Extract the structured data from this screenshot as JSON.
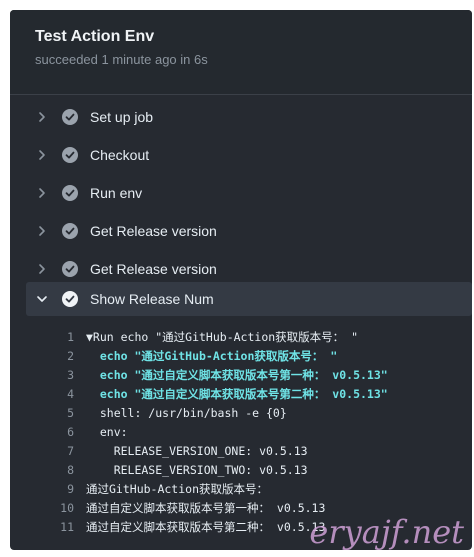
{
  "header": {
    "title": "Test Action Env",
    "subtitle": "succeeded 1 minute ago in 6s"
  },
  "steps": [
    {
      "label": "Set up job",
      "expanded": false
    },
    {
      "label": "Checkout",
      "expanded": false
    },
    {
      "label": "Run env",
      "expanded": false
    },
    {
      "label": "Get Release version",
      "expanded": false
    },
    {
      "label": "Get Release version",
      "expanded": false
    },
    {
      "label": "Show Release Num",
      "expanded": true
    }
  ],
  "log": [
    {
      "n": "1",
      "text": "▼Run echo \"通过GitHub-Action获取版本号： \"",
      "style": "normal"
    },
    {
      "n": "2",
      "text": "  echo \"通过GitHub-Action获取版本号： \"",
      "style": "cyan"
    },
    {
      "n": "3",
      "text": "  echo \"通过自定义脚本获取版本号第一种： v0.5.13\"",
      "style": "cyan"
    },
    {
      "n": "4",
      "text": "  echo \"通过自定义脚本获取版本号第二种： v0.5.13\"",
      "style": "cyan"
    },
    {
      "n": "5",
      "text": "  shell: /usr/bin/bash -e {0}",
      "style": "normal"
    },
    {
      "n": "6",
      "text": "  env:",
      "style": "normal"
    },
    {
      "n": "7",
      "text": "    RELEASE_VERSION_ONE: v0.5.13",
      "style": "normal"
    },
    {
      "n": "8",
      "text": "    RELEASE_VERSION_TWO: v0.5.13",
      "style": "normal"
    },
    {
      "n": "9",
      "text": "通过GitHub-Action获取版本号：",
      "style": "normal"
    },
    {
      "n": "10",
      "text": "通过自定义脚本获取版本号第一种： v0.5.13",
      "style": "normal"
    },
    {
      "n": "11",
      "text": "通过自定义脚本获取版本号第二种： v0.5.13",
      "style": "normal"
    }
  ],
  "watermark": "eryajf.net",
  "colors": {
    "background": "#262a31",
    "text": "#e6edf3",
    "muted": "#8b949e",
    "highlight": "#6fe3e6",
    "active_row": "#343a44"
  }
}
